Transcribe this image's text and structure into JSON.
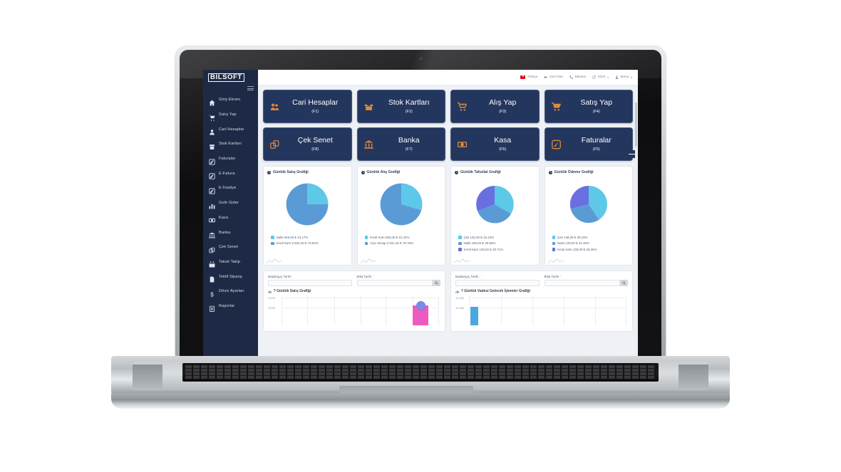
{
  "brand": {
    "name": "BILSOFT"
  },
  "sidebar": {
    "items": [
      {
        "label": "Giriş Ekranı",
        "icon": "home-icon"
      },
      {
        "label": "Satış Yap",
        "icon": "cart-icon"
      },
      {
        "label": "Cari Hesaplar",
        "icon": "users-icon"
      },
      {
        "label": "Stok Kartları",
        "icon": "box-icon"
      },
      {
        "label": "Faturalar",
        "icon": "invoice-icon"
      },
      {
        "label": "E-Fatura",
        "icon": "invoice-icon"
      },
      {
        "label": "E-İrsaliye",
        "icon": "invoice-icon"
      },
      {
        "label": "Gelir Gider",
        "icon": "bar-chart-icon"
      },
      {
        "label": "Kasa",
        "icon": "cash-icon"
      },
      {
        "label": "Banka",
        "icon": "bank-icon"
      },
      {
        "label": "Çek Senet",
        "icon": "documents-icon"
      },
      {
        "label": "Taksit Takip",
        "icon": "calendar-icon"
      },
      {
        "label": "Teklif Sipariş",
        "icon": "file-icon"
      },
      {
        "label": "Döviz Ayarları",
        "icon": "dollar-icon"
      },
      {
        "label": "Raporlar",
        "icon": "report-icon"
      }
    ]
  },
  "topbar": {
    "language": "Türkçe",
    "back": "Geri Dön",
    "branch": "Merkez",
    "year": "2024",
    "user": "demo"
  },
  "tiles": [
    {
      "label": "Cari Hesaplar",
      "key": "(F1)",
      "icon": "users-icon"
    },
    {
      "label": "Stok Kartları",
      "key": "(F2)",
      "icon": "box-icon"
    },
    {
      "label": "Alış Yap",
      "key": "(F3)",
      "icon": "cart-in-icon"
    },
    {
      "label": "Satış Yap",
      "key": "(F4)",
      "icon": "cart-icon"
    },
    {
      "label": "Çek Senet",
      "key": "(F8)",
      "icon": "documents-icon"
    },
    {
      "label": "Banka",
      "key": "(F7)",
      "icon": "bank-icon"
    },
    {
      "label": "Kasa",
      "key": "(F6)",
      "icon": "cash-icon"
    },
    {
      "label": "Faturalar",
      "key": "(F5)",
      "icon": "invoice-icon"
    }
  ],
  "chart_data": [
    {
      "type": "pie",
      "title": "Günlük Satış Grafiği",
      "categories": [
        "Nakit",
        "Kredi Kartı"
      ],
      "values": [
        845.5,
        2804.4
      ],
      "percents": [
        23.17,
        76.83
      ],
      "colors": [
        "#5ec8e8",
        "#5b9bd5"
      ],
      "legend_position": "bottom",
      "legend": [
        "Nakit 845,50 ₺ 23.17%",
        "Kredi Kartı 2.804,40 ₺ 76.83%"
      ]
    },
    {
      "type": "pie",
      "title": "Günlük Alış Grafiği",
      "categories": [
        "Kredi Kartı",
        "Açık Hesap"
      ],
      "values": [
        550.0,
        2041.4
      ],
      "percents": [
        21.22,
        78.78
      ],
      "colors": [
        "#5ec8e8",
        "#5b9bd5"
      ],
      "legend_position": "bottom",
      "legend": [
        "Kredi Kartı 550,00 ₺ 21.22%",
        "Açık Hesap 2.041,40 ₺ 78.78%"
      ]
    },
    {
      "type": "pie",
      "title": "Günlük Tahsilat Grafiği",
      "categories": [
        "Çek",
        "Nakit",
        "Kredi Kartı"
      ],
      "values": [
        132.0,
        150.0,
        125.0
      ],
      "percents": [
        32.43,
        36.86,
        30.71
      ],
      "colors": [
        "#5ec8e8",
        "#5b9bd5",
        "#6a6fe0"
      ],
      "legend_position": "bottom",
      "legend": [
        "Çek 132,00 ₺ 32.43%",
        "Nakit 150,00 ₺ 36.86%",
        "Kredi Kartı 125,00 ₺ 30.71%"
      ]
    },
    {
      "type": "pie",
      "title": "Günlük Ödeme Grafiği",
      "categories": [
        "Çek",
        "Nakit",
        "Kredi Kartı"
      ],
      "values": [
        148.0,
        130.0,
        100.0
      ],
      "percents": [
        39.15,
        34.39,
        26.46
      ],
      "colors": [
        "#5ec8e8",
        "#5b9bd5",
        "#6a6fe0"
      ],
      "legend_position": "bottom",
      "legend": [
        "Çek 148,00 ₺ 39.15%",
        "Nakit 130,00 ₺ 34.39%",
        "Kredi Kartı 100,00 ₺ 26.46%"
      ]
    },
    {
      "type": "bar",
      "title": "7 Günlük Satış Grafiği",
      "categories": [
        "",
        "",
        "",
        "",
        "",
        "",
        ""
      ],
      "values": [
        0,
        0,
        0,
        0,
        0,
        0,
        3650
      ],
      "ylabel": "",
      "xlabel": "",
      "yticks": [
        "4.000",
        "3.000"
      ],
      "ylim": [
        0,
        4000
      ],
      "grid": true,
      "bar_color": "#ef5ac0",
      "marker_color": "#7b8ce8"
    },
    {
      "type": "bar",
      "title": "7 Günlük Vadesi Gelecek İşlemler Grafiği",
      "categories": [
        "",
        "",
        "",
        "",
        "",
        "",
        ""
      ],
      "values": [
        10000,
        0,
        0,
        0,
        0,
        0,
        0
      ],
      "ylabel": "",
      "xlabel": "",
      "yticks": [
        "12.000",
        "10.000"
      ],
      "ylim": [
        0,
        12000
      ],
      "grid": true,
      "bar_color": "#4aa7e0"
    }
  ],
  "filters": {
    "left": {
      "start_label": "Başlangıç Tarihi :",
      "start_value": "",
      "start_placeholder": "",
      "end_label": "Bitiş Tarihi :",
      "end_value": "",
      "end_placeholder": "",
      "search_icon": "search-icon"
    },
    "right": {
      "start_label": "Başlangıç Tarihi :",
      "start_value": "",
      "start_placeholder": "",
      "end_label": "Bitiş Tarihi :",
      "end_value": "",
      "end_placeholder": "",
      "search_icon": "search-icon"
    }
  },
  "colors": {
    "sidebar_bg": "#1e2a45",
    "tile_bg": "#23365e",
    "tile_icon": "#e08a3c",
    "page_bg": "#eef1f5"
  }
}
